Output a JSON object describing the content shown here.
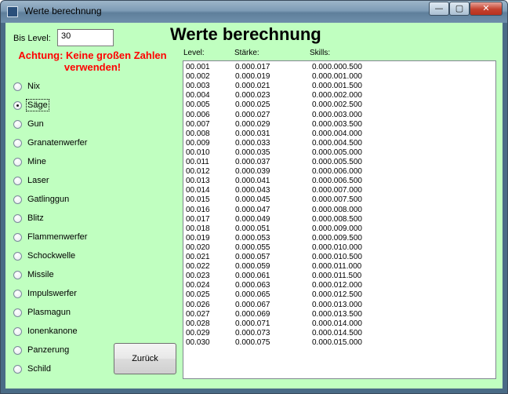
{
  "window": {
    "title": "Werte berechnung",
    "controls": {
      "minimize": "—",
      "maximize": "▢",
      "close": "✕"
    }
  },
  "form": {
    "bis_level_label": "Bis Level:",
    "bis_level_value": "30",
    "heading": "Werte berechnung",
    "warning_line1": "Achtung: Keine großen Zahlen",
    "warning_line2": "verwenden!",
    "back_button": "Zurück"
  },
  "weapons": {
    "selected": "Säge",
    "items": [
      "Nix",
      "Säge",
      "Gun",
      "Granatenwerfer",
      "Mine",
      "Laser",
      "Gatlinggun",
      "Blitz",
      "Flammenwerfer",
      "Schockwelle",
      "Missile",
      "Impulswerfer",
      "Plasmagun",
      "Ionenkanone",
      "Panzerung",
      "Schild"
    ]
  },
  "table": {
    "headers": {
      "level": "Level:",
      "staerke": "Stärke:",
      "skills": "Skills:"
    },
    "rows": [
      [
        "00.001",
        "0.000.017",
        "0.000.000.500"
      ],
      [
        "00.002",
        "0.000.019",
        "0.000.001.000"
      ],
      [
        "00.003",
        "0.000.021",
        "0.000.001.500"
      ],
      [
        "00.004",
        "0.000.023",
        "0.000.002.000"
      ],
      [
        "00.005",
        "0.000.025",
        "0.000.002.500"
      ],
      [
        "00.006",
        "0.000.027",
        "0.000.003.000"
      ],
      [
        "00.007",
        "0.000.029",
        "0.000.003.500"
      ],
      [
        "00.008",
        "0.000.031",
        "0.000.004.000"
      ],
      [
        "00.009",
        "0.000.033",
        "0.000.004.500"
      ],
      [
        "00.010",
        "0.000.035",
        "0.000.005.000"
      ],
      [
        "00.011",
        "0.000.037",
        "0.000.005.500"
      ],
      [
        "00.012",
        "0.000.039",
        "0.000.006.000"
      ],
      [
        "00.013",
        "0.000.041",
        "0.000.006.500"
      ],
      [
        "00.014",
        "0.000.043",
        "0.000.007.000"
      ],
      [
        "00.015",
        "0.000.045",
        "0.000.007.500"
      ],
      [
        "00.016",
        "0.000.047",
        "0.000.008.000"
      ],
      [
        "00.017",
        "0.000.049",
        "0.000.008.500"
      ],
      [
        "00.018",
        "0.000.051",
        "0.000.009.000"
      ],
      [
        "00.019",
        "0.000.053",
        "0.000.009.500"
      ],
      [
        "00.020",
        "0.000.055",
        "0.000.010.000"
      ],
      [
        "00.021",
        "0.000.057",
        "0.000.010.500"
      ],
      [
        "00.022",
        "0.000.059",
        "0.000.011.000"
      ],
      [
        "00.023",
        "0.000.061",
        "0.000.011.500"
      ],
      [
        "00.024",
        "0.000.063",
        "0.000.012.000"
      ],
      [
        "00.025",
        "0.000.065",
        "0.000.012.500"
      ],
      [
        "00.026",
        "0.000.067",
        "0.000.013.000"
      ],
      [
        "00.027",
        "0.000.069",
        "0.000.013.500"
      ],
      [
        "00.028",
        "0.000.071",
        "0.000.014.000"
      ],
      [
        "00.029",
        "0.000.073",
        "0.000.014.500"
      ],
      [
        "00.030",
        "0.000.075",
        "0.000.015.000"
      ]
    ]
  },
  "colors": {
    "form_background": "#c0ffc0",
    "warning": "#ff0000"
  }
}
